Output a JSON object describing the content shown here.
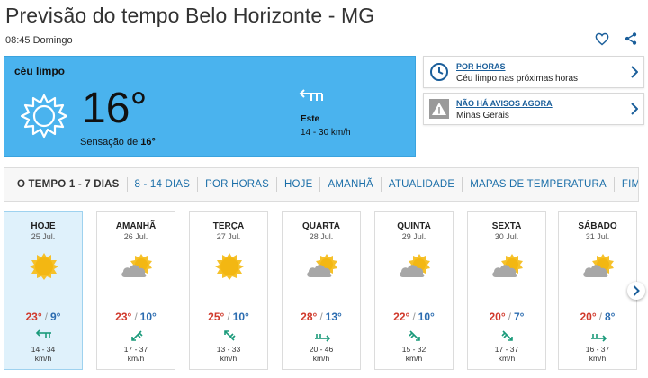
{
  "header": {
    "title": "Previsão do tempo Belo Horizonte - MG",
    "datetime": "08:45 Domingo"
  },
  "current": {
    "condition": "céu limpo",
    "temperature": "16°",
    "feels_label": "Sensação de",
    "feels_value": "16°",
    "wind_direction": "Este",
    "wind_speed": "14 - 30 km/h"
  },
  "cards": [
    {
      "title": "POR HORAS",
      "text": "Céu limpo nas próximas horas",
      "icon": "clock-icon"
    },
    {
      "title": "NÃO HÁ AVISOS AGORA",
      "text": "Minas Gerais",
      "icon": "warning-icon"
    }
  ],
  "tabs": [
    "O TEMPO 1 - 7 DIAS",
    "8 - 14 DIAS",
    "POR HORAS",
    "HOJE",
    "AMANHÃ",
    "ATUALIDADE",
    "MAPAS DE TEMPERATURA",
    "FIM-DE"
  ],
  "days": [
    {
      "name": "HOJE",
      "date": "25 Jul.",
      "icon": "sun-icon",
      "max": "23°",
      "min": "9°",
      "wind": "14 - 34",
      "unit": "km/h"
    },
    {
      "name": "AMANHÃ",
      "date": "26 Jul.",
      "icon": "cloud-sun-icon",
      "max": "23°",
      "min": "10°",
      "wind": "17 - 37",
      "unit": "km/h"
    },
    {
      "name": "TERÇA",
      "date": "27 Jul.",
      "icon": "sun-icon",
      "max": "25°",
      "min": "10°",
      "wind": "13 - 33",
      "unit": "km/h"
    },
    {
      "name": "QUARTA",
      "date": "28 Jul.",
      "icon": "cloud-sun-icon",
      "max": "28°",
      "min": "13°",
      "wind": "20 - 46",
      "unit": "km/h"
    },
    {
      "name": "QUINTA",
      "date": "29 Jul.",
      "icon": "cloud-sun-icon",
      "max": "22°",
      "min": "10°",
      "wind": "15 - 32",
      "unit": "km/h"
    },
    {
      "name": "SEXTA",
      "date": "30 Jul.",
      "icon": "cloud-sun-icon",
      "max": "20°",
      "min": "7°",
      "wind": "17 - 37",
      "unit": "km/h"
    },
    {
      "name": "SÁBADO",
      "date": "31 Jul.",
      "icon": "cloud-sun-icon",
      "max": "20°",
      "min": "8°",
      "wind": "16 - 37",
      "unit": "km/h"
    }
  ],
  "colors": {
    "current_bg": "#4ab3ee",
    "link": "#1a6ea8",
    "max_temp": "#d0392b",
    "min_temp": "#2b6cb0",
    "active_day_bg": "#dff1fb"
  }
}
